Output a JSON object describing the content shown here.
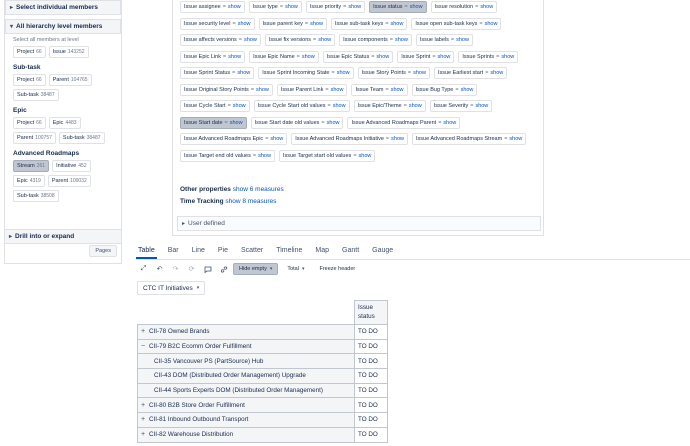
{
  "left_panel": {
    "select_members": "Select individual members",
    "all_hierarchy": "All hierarchy level members",
    "hint": "Select all members at level",
    "groups": [
      {
        "title": "",
        "chips": [
          {
            "label": "Project",
            "count": "66"
          },
          {
            "label": "Issue",
            "count": "143252"
          }
        ]
      },
      {
        "title": "Sub-task",
        "chips": [
          {
            "label": "Project",
            "count": "66"
          },
          {
            "label": "Parent",
            "count": "104765"
          },
          {
            "label": "Sub-task",
            "count": "38487"
          }
        ]
      },
      {
        "title": "Epic",
        "chips": [
          {
            "label": "Project",
            "count": "66"
          },
          {
            "label": "Epic",
            "count": "4483"
          },
          {
            "label": "Parent",
            "count": "100757"
          },
          {
            "label": "Sub-task",
            "count": "38487"
          }
        ]
      },
      {
        "title": "Advanced Roadmaps",
        "chips": [
          {
            "label": "Stream",
            "count": "261",
            "selected": true
          },
          {
            "label": "Initiative",
            "count": "452"
          },
          {
            "label": "Epic",
            "count": "4319"
          },
          {
            "label": "Parent",
            "count": "100032"
          },
          {
            "label": "Sub-task",
            "count": "38508"
          }
        ]
      }
    ],
    "drill": "Drill into or expand",
    "pages": "Pages"
  },
  "measures": {
    "pills": [
      {
        "label": "Issue assignee",
        "active": false
      },
      {
        "label": "Issue type",
        "active": false
      },
      {
        "label": "Issue priority",
        "active": false
      },
      {
        "label": "Issue status",
        "active": true
      },
      {
        "label": "Issue resolution",
        "active": false
      },
      {
        "label": "Issue security level",
        "active": false
      },
      {
        "label": "Issue parent key",
        "active": false
      },
      {
        "label": "Issue sub-task keys",
        "active": false
      },
      {
        "label": "Issue open sub-task keys",
        "active": false
      },
      {
        "label": "Issue affects versions",
        "active": false
      },
      {
        "label": "Issue fix versions",
        "active": false
      },
      {
        "label": "Issue components",
        "active": false
      },
      {
        "label": "Issue labels",
        "active": false
      },
      {
        "label": "Issue Epic Link",
        "active": false
      },
      {
        "label": "Issue Epic Name",
        "active": false
      },
      {
        "label": "Issue Epic Status",
        "active": false
      },
      {
        "label": "Issue Sprint",
        "active": false
      },
      {
        "label": "Issue Sprints",
        "active": false
      },
      {
        "label": "Issue Sprint Status",
        "active": false
      },
      {
        "label": "Issue Sprint Incoming State",
        "active": false
      },
      {
        "label": "Issue Story Points",
        "active": false
      },
      {
        "label": "Issue Earliest start",
        "active": false
      },
      {
        "label": "Issue Original Story Points",
        "active": false
      },
      {
        "label": "Issue Parent Link",
        "active": false
      },
      {
        "label": "Issue Team",
        "active": false
      },
      {
        "label": "Issue Bug Type",
        "active": false
      },
      {
        "label": "Issue Cycle Start",
        "active": false
      },
      {
        "label": "Issue Cycle Start old values",
        "active": false
      },
      {
        "label": "Issue Epic/Theme",
        "active": false
      },
      {
        "label": "Issue Severity",
        "active": false
      },
      {
        "label": "Issue Start date",
        "active": true
      },
      {
        "label": "Issue Start date old values",
        "active": false
      },
      {
        "label": "Issue Advanced Roadmaps Parent",
        "active": false
      },
      {
        "label": "Issue Advanced Roadmaps Epic",
        "active": false
      },
      {
        "label": "Issue Advanced Roadmaps Initiative",
        "active": false
      },
      {
        "label": "Issue Advanced Roadmaps Stream",
        "active": false
      },
      {
        "label": "Issue Target end old values",
        "active": false
      },
      {
        "label": "Issue Target start old values",
        "active": false
      }
    ],
    "eq": "=",
    "show": "show",
    "other_properties_label": "Other properties",
    "other_properties_link": "show 6 measures",
    "time_tracking_label": "Time Tracking",
    "time_tracking_link": "show 8 measures",
    "user_defined": "User defined"
  },
  "vis_tabs": [
    "Table",
    "Bar",
    "Line",
    "Pie",
    "Scatter",
    "Timeline",
    "Map",
    "Gantt",
    "Gauge"
  ],
  "toolbar": {
    "hide_empty": "Hide empty",
    "total": "Total",
    "freeze_header": "Freeze header"
  },
  "dimension_select": "CTC IT Initiatives",
  "table": {
    "column_header": "Issue status",
    "rows": [
      {
        "label": "CII-78 Owned Brands",
        "toggle": "+",
        "child": false,
        "value": "TO DO"
      },
      {
        "label": "CII-79 B2C Ecomm Order Fulfillment",
        "toggle": "−",
        "child": false,
        "value": "TO DO"
      },
      {
        "label": "CII-35 Vancouver PS (PartSource) Hub",
        "toggle": "",
        "child": true,
        "value": "TO DO"
      },
      {
        "label": "CII-43 DOM (Distributed Order Management) Upgrade",
        "toggle": "",
        "child": true,
        "value": "TO DO"
      },
      {
        "label": "CII-44 Sports Experts DOM (Distributed Order Management)",
        "toggle": "",
        "child": true,
        "value": "TO DO"
      },
      {
        "label": "CII-80 B2B Store Order Fulfillment",
        "toggle": "+",
        "child": false,
        "value": "TO DO"
      },
      {
        "label": "CII-81 Inbound Outbound Transport",
        "toggle": "+",
        "child": false,
        "value": "TO DO"
      },
      {
        "label": "CII-82 Warehouse Distribution",
        "toggle": "+",
        "child": false,
        "value": "TO DO"
      }
    ]
  }
}
